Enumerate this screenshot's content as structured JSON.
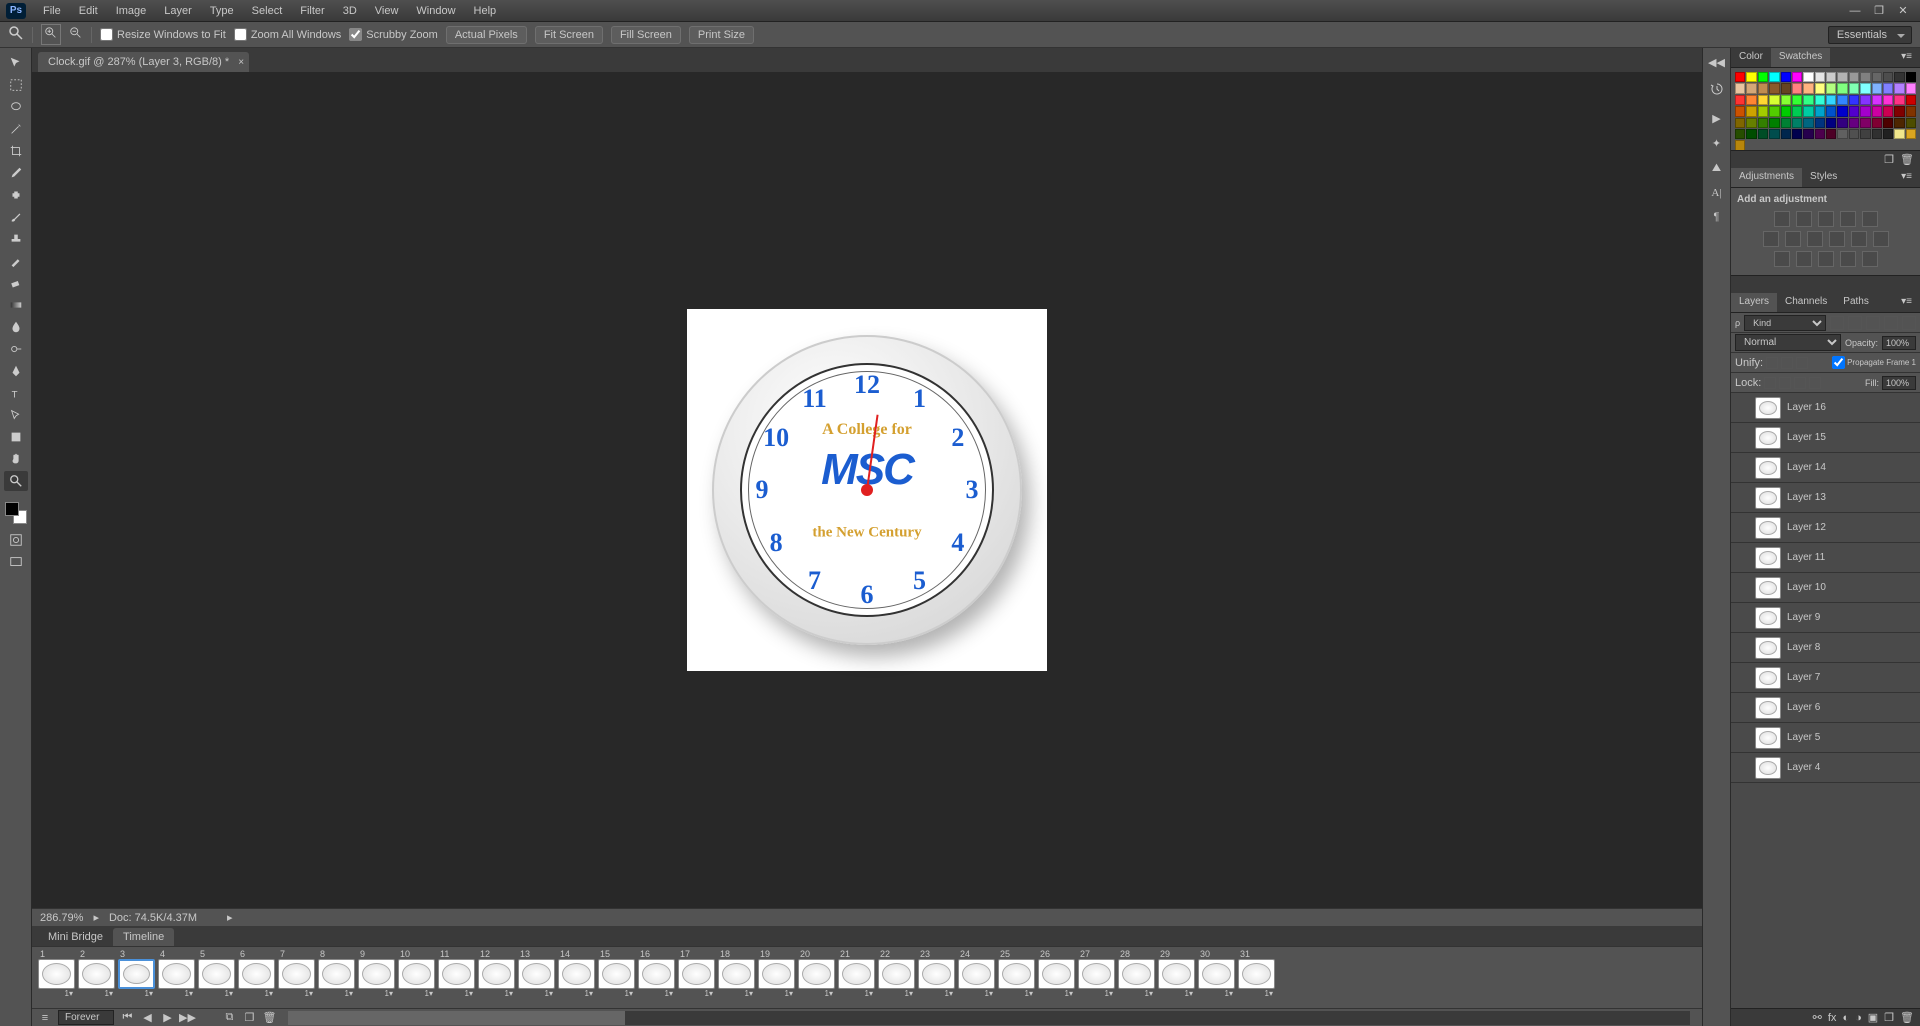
{
  "menu": [
    "File",
    "Edit",
    "Image",
    "Layer",
    "Type",
    "Select",
    "Filter",
    "3D",
    "View",
    "Window",
    "Help"
  ],
  "ps": "Ps",
  "optbar": {
    "resize": "Resize Windows to Fit",
    "zoomall": "Zoom All Windows",
    "scrubby": "Scrubby Zoom",
    "actual": "Actual Pixels",
    "fitscreen": "Fit Screen",
    "fillscreen": "Fill Screen",
    "printsize": "Print Size"
  },
  "workspace": "Essentials",
  "doc_tab": "Clock.gif @ 287% (Layer 3, RGB/8) *",
  "clock": {
    "nums": [
      "12",
      "1",
      "2",
      "3",
      "4",
      "5",
      "6",
      "7",
      "8",
      "9",
      "10",
      "11"
    ],
    "brand": "MSC",
    "slogan_top": "A College for",
    "slogan_bot": "the New Century"
  },
  "status": {
    "zoom": "286.79%",
    "doc": "Doc: 74.5K/4.37M"
  },
  "timeline": {
    "tabs": [
      "Mini Bridge",
      "Timeline"
    ],
    "frames": [
      1,
      2,
      3,
      4,
      5,
      6,
      7,
      8,
      9,
      10,
      11,
      12,
      13,
      14,
      15,
      16,
      17,
      18,
      19,
      20,
      21,
      22,
      23,
      24,
      25,
      26,
      27,
      28,
      29,
      30,
      31
    ],
    "selected": 3,
    "delay": "1▾",
    "loop": "Forever"
  },
  "panels": {
    "color_tabs": [
      "Color",
      "Swatches"
    ],
    "adj_tabs": [
      "Adjustments",
      "Styles"
    ],
    "adj_title": "Add an adjustment",
    "lay_tabs": [
      "Layers",
      "Channels",
      "Paths"
    ],
    "kind": "Kind",
    "blend": "Normal",
    "opacity_lbl": "Opacity:",
    "opacity": "100%",
    "unify": "Unify:",
    "propagate": "Propagate Frame 1",
    "lock": "Lock:",
    "fill_lbl": "Fill:",
    "fill": "100%"
  },
  "layers": [
    "Layer 16",
    "Layer 15",
    "Layer 14",
    "Layer 13",
    "Layer 12",
    "Layer 11",
    "Layer 10",
    "Layer 9",
    "Layer 8",
    "Layer 7",
    "Layer 6",
    "Layer 5",
    "Layer 4"
  ],
  "swatch_colors": [
    "#ff0000",
    "#ffff00",
    "#00ff00",
    "#00ffff",
    "#0000ff",
    "#ff00ff",
    "#ffffff",
    "#e6e6e6",
    "#cccccc",
    "#b3b3b3",
    "#999999",
    "#808080",
    "#666666",
    "#4d4d4d",
    "#333333",
    "#000000",
    "#e8c4a0",
    "#d4a878",
    "#c08c50",
    "#8b5a2b",
    "#654321",
    "#ff8080",
    "#ffb380",
    "#ffff80",
    "#b3ff80",
    "#80ff80",
    "#80ffb3",
    "#80ffff",
    "#80b3ff",
    "#8080ff",
    "#b380ff",
    "#ff80ff",
    "#ff3333",
    "#ff8533",
    "#ffd633",
    "#d6ff33",
    "#85ff33",
    "#33ff33",
    "#33ff85",
    "#33ffd6",
    "#33d6ff",
    "#3385ff",
    "#3333ff",
    "#8533ff",
    "#d633ff",
    "#ff33d6",
    "#ff3385",
    "#cc0000",
    "#cc5200",
    "#cca300",
    "#a3cc00",
    "#52cc00",
    "#00cc00",
    "#00cc52",
    "#00cca3",
    "#00a3cc",
    "#0052cc",
    "#0000cc",
    "#5200cc",
    "#a300cc",
    "#cc00a3",
    "#cc0052",
    "#800000",
    "#803300",
    "#806600",
    "#668000",
    "#338000",
    "#008000",
    "#008033",
    "#008066",
    "#006680",
    "#003380",
    "#000080",
    "#330080",
    "#660080",
    "#800066",
    "#800033",
    "#4d0000",
    "#4d2600",
    "#4d4d00",
    "#264d00",
    "#004d00",
    "#004d26",
    "#004d4d",
    "#00264d",
    "#00004d",
    "#26004d",
    "#4d004d",
    "#4d0026",
    "#606060",
    "#505050",
    "#404040",
    "#303030",
    "#202020",
    "#f0e68c",
    "#daa520",
    "#b8860b"
  ]
}
